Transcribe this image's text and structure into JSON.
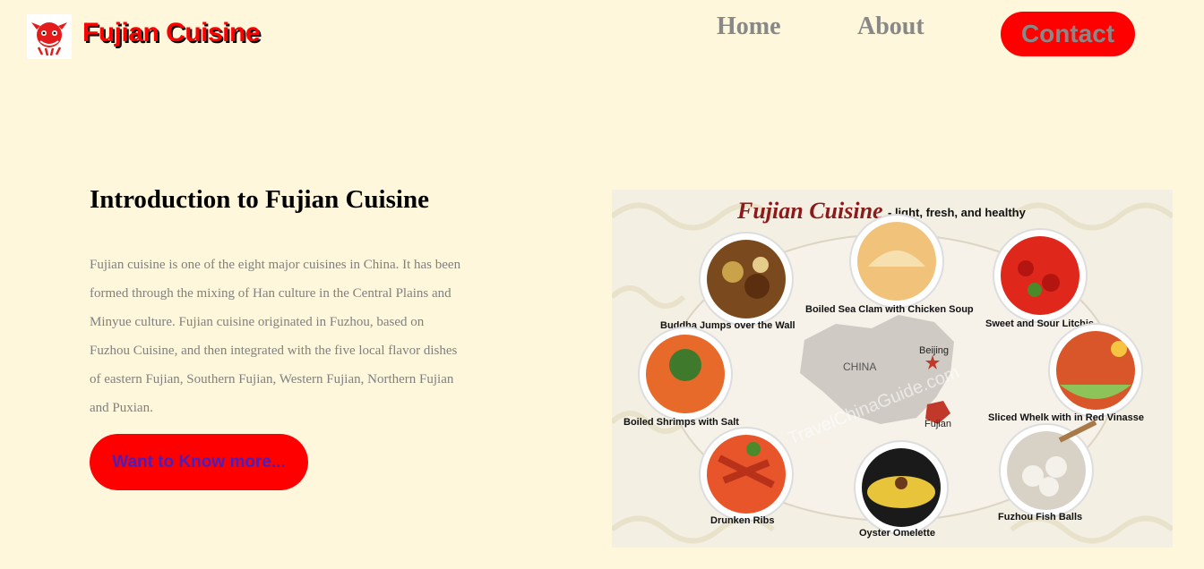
{
  "header": {
    "brand": "Fujian Cuisine",
    "nav": {
      "home": "Home",
      "about": "About",
      "contact": "Contact"
    }
  },
  "intro": {
    "title": "Introduction to Fujian Cuisine",
    "body": "Fujian cuisine is one of the eight major cuisines in China. It has been formed through the mixing of Han culture in the Central Plains and Minyue culture. Fujian cuisine originated in Fuzhou, based on Fuzhou Cuisine, and then integrated with the five local flavor dishes of eastern Fujian, Southern Fujian, Western Fujian, Northern Fujian and Puxian.",
    "button": "Want to Know more..."
  },
  "graphic": {
    "title_script": "Fujian Cuisine",
    "tagline": "- light, fresh, and healthy",
    "map_country": "CHINA",
    "map_capital": "Beijing",
    "map_province": "Fujian",
    "watermark": "TravelChinaGuide.com",
    "dishes": [
      "Buddha Jumps over the Wall",
      "Boiled Sea Clam with Chicken Soup",
      "Sweet and Sour Litchis",
      "Boiled Shrimps with Salt",
      "Sliced Whelk with in Red Vinasse",
      "Drunken Ribs",
      "Oyster Omelette",
      "Fuzhou Fish Balls"
    ]
  },
  "colors": {
    "background": "#fef7dc",
    "accent": "#ff0000",
    "nav_text": "#888888",
    "button_text": "#4a1fbf"
  }
}
